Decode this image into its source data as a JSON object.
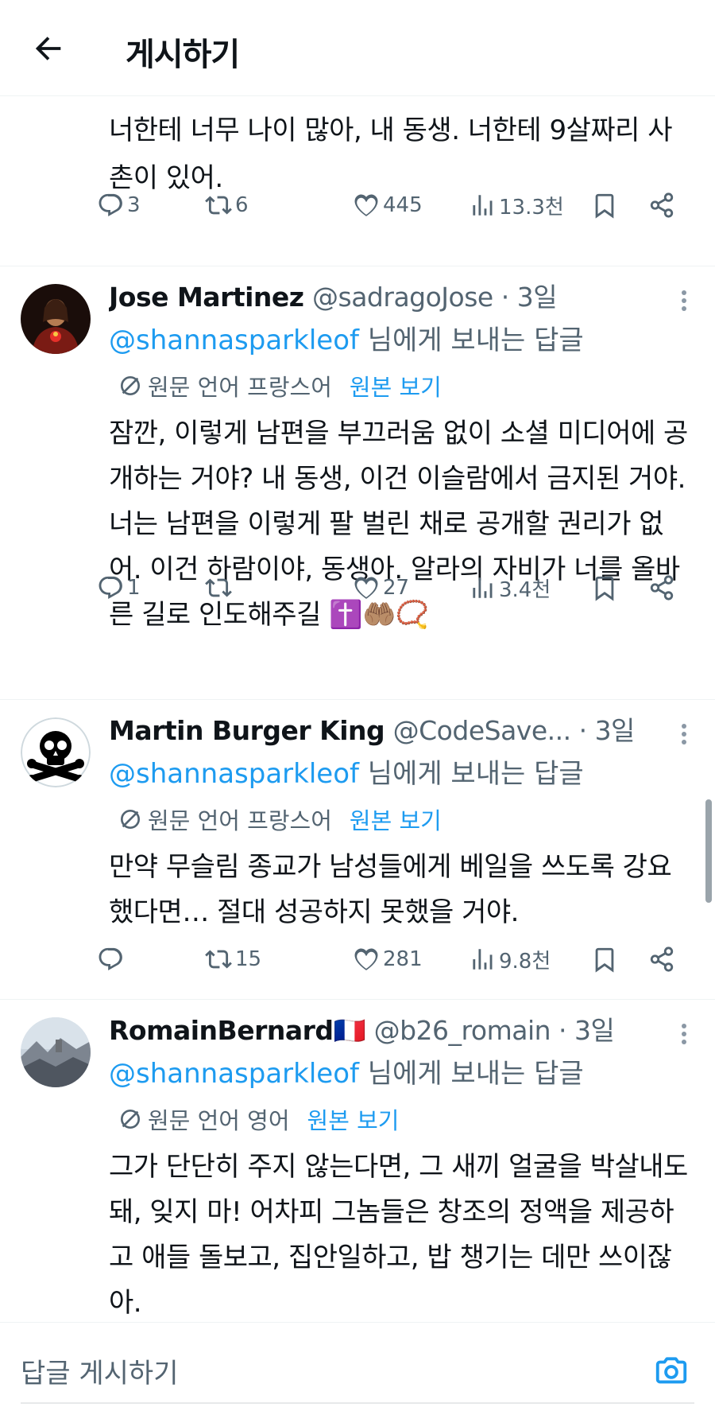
{
  "header": {
    "title": "게시하기"
  },
  "top_post": {
    "text": "너한테 너무 나이 많아, 내 동생. 너한테 9살짜리 사촌이 있어.",
    "replies": "3",
    "reposts": "6",
    "likes": "445",
    "views": "13.3천"
  },
  "tweets": [
    {
      "name": "Jose Martinez",
      "handle": "@sadragoJose · 3일",
      "mention": "@shannasparkleof",
      "reply_suffix": " 님에게 보내는 답글",
      "translate_lang": "원문 언어 프랑스어",
      "translate_link": "원본 보기",
      "text": "잠깐, 이렇게 남편을 부끄러움 없이 소셜 미디어에 공개하는 거야? 내 동생, 이건 이슬람에서 금지된 거야. 너는 남편을 이렇게 팔 벌린 채로 공개할 권리가 없어. 이건 하람이야, 동생아. 알라의 자비가 너를 올바른 길로 인도해주길 ✝️🤲🏽📿",
      "replies": "1",
      "reposts": "",
      "likes": "27",
      "views": "3.4천"
    },
    {
      "name": "Martin Burger King",
      "handle": "@CodeSave...  · 3일",
      "mention": "@shannasparkleof",
      "reply_suffix": " 님에게 보내는 답글",
      "translate_lang": "원문 언어 프랑스어",
      "translate_link": "원본 보기",
      "text": "만약 무슬림 종교가 남성들에게 베일을 쓰도록 강요했다면… 절대 성공하지 못했을 거야.",
      "replies": "",
      "reposts": "15",
      "likes": "281",
      "views": "9.8천"
    },
    {
      "name": "RomainBernard🇫🇷",
      "handle": "@b26_romain · 3일",
      "mention": "@shannasparkleof",
      "reply_suffix": " 님에게 보내는 답글",
      "translate_lang": "원문 언어 영어",
      "translate_link": "원본 보기",
      "text": "그가 단단히 주지 않는다면, 그 새끼 얼굴을 박살내도 돼, 잊지 마! 어차피 그놈들은 창조의 정액을 제공하고 애들 돌보고, 집안일하고, 밥 챙기는 데만 쓰이잖아."
    }
  ],
  "composer": {
    "placeholder": "답글 게시하기"
  },
  "icons": {
    "back": "arrow-left-icon",
    "reply": "reply-icon",
    "repost": "repost-icon",
    "like": "heart-icon",
    "views": "views-icon",
    "bookmark": "bookmark-icon",
    "share": "share-icon",
    "translate": "translate-icon",
    "camera": "camera-icon",
    "more": "more-icon"
  },
  "colors": {
    "accent": "#1d9bf0",
    "secondary_text": "#536471",
    "divider": "#eff3f4"
  }
}
